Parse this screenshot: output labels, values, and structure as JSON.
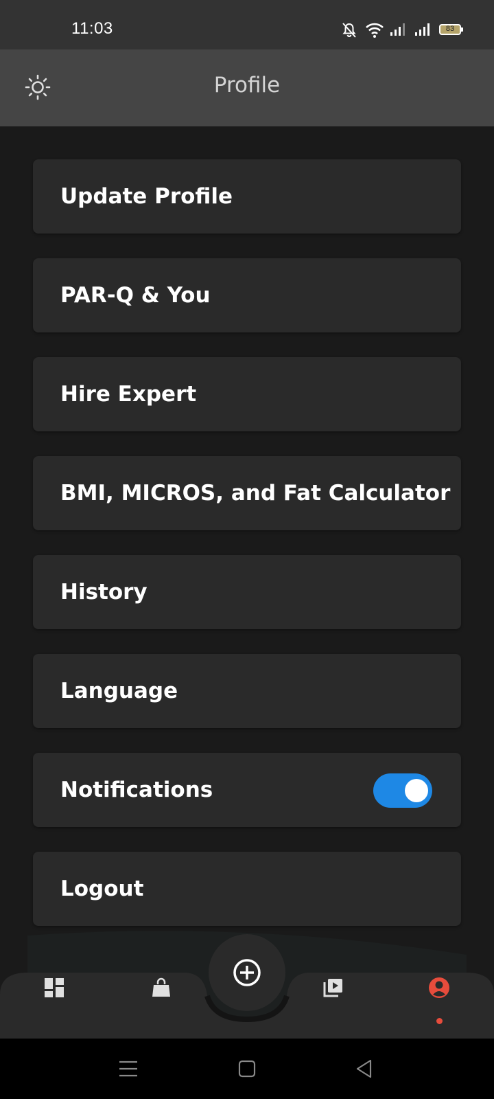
{
  "status_bar": {
    "time": "11:03",
    "battery_level": "83",
    "icons": [
      "bell-off-icon",
      "wifi-icon",
      "signal-icon",
      "signal-icon",
      "battery-icon"
    ]
  },
  "header": {
    "title": "Profile",
    "theme_icon": "sun-icon"
  },
  "menu": {
    "items": [
      {
        "label": "Update Profile"
      },
      {
        "label": "PAR-Q & You"
      },
      {
        "label": "Hire Expert"
      },
      {
        "label": "BMI, MICROS, and Fat Calculator"
      },
      {
        "label": "History"
      },
      {
        "label": "Language"
      },
      {
        "label": "Notifications",
        "toggle_on": true
      },
      {
        "label": "Logout"
      }
    ]
  },
  "bottom_nav": {
    "items": [
      "dashboard-icon",
      "shopping-bag-icon",
      "add-circle-icon",
      "video-library-icon",
      "profile-icon"
    ],
    "active": "profile-icon",
    "active_color": "#e74c3c"
  },
  "colors": {
    "background": "#1a1a1a",
    "card": "#2a2a2a",
    "header": "#454545",
    "toggle_on": "#1e88e5"
  }
}
